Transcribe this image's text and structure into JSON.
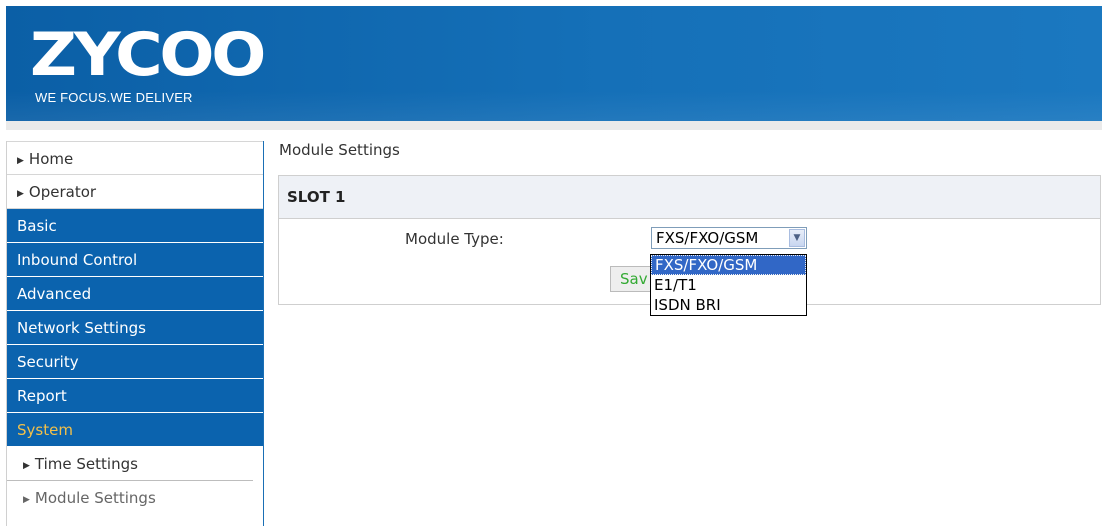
{
  "header": {
    "logo_text": "ZYCOO",
    "tagline": "WE FOCUS.WE DELIVER"
  },
  "sidebar": {
    "items": [
      {
        "label": "Home",
        "style": "light"
      },
      {
        "label": "Operator",
        "style": "light"
      },
      {
        "label": "Basic",
        "style": "dark"
      },
      {
        "label": "Inbound Control",
        "style": "dark"
      },
      {
        "label": "Advanced",
        "style": "dark"
      },
      {
        "label": "Network Settings",
        "style": "dark"
      },
      {
        "label": "Security",
        "style": "dark"
      },
      {
        "label": "Report",
        "style": "dark"
      },
      {
        "label": "System",
        "style": "dark-active"
      }
    ],
    "sub_items": [
      {
        "label": "Time Settings"
      },
      {
        "label": "Module Settings"
      }
    ]
  },
  "main": {
    "page_title": "Module Settings",
    "panel_title": "SLOT 1",
    "module_type_label": "Module Type:",
    "module_type_value": "FXS/FXO/GSM",
    "save_label_visible": "Sav",
    "dropdown_options": [
      "FXS/FXO/GSM",
      "E1/T1",
      "ISDN BRI"
    ],
    "dropdown_selected": "FXS/FXO/GSM"
  },
  "colors": {
    "header_blue": "#0b5fa6",
    "sidebar_blue": "#0b63ae",
    "active_text": "#f2c04a",
    "selection_blue": "#3167c6",
    "save_green": "#33aa33"
  },
  "icons": {
    "sidebar_bullet": "triangle-right-icon",
    "select_arrow": "chevron-down-icon"
  }
}
